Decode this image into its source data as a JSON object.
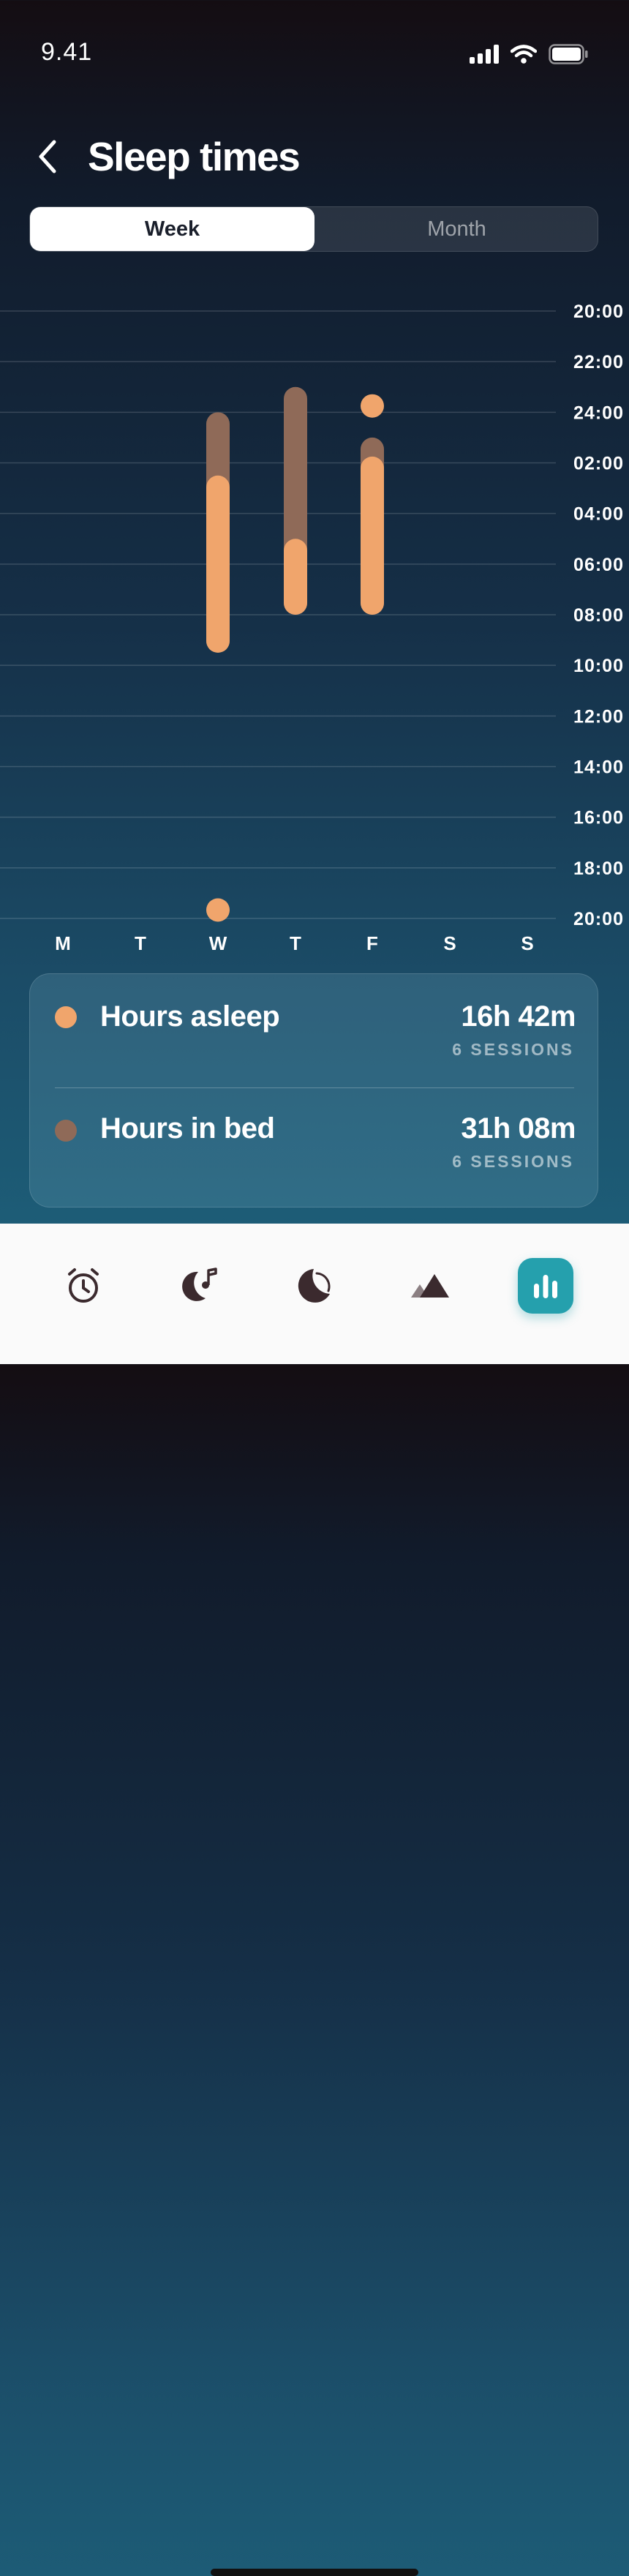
{
  "status_bar": {
    "time": "9.41",
    "icons": [
      "signal-icon",
      "wifi-icon",
      "battery-icon"
    ]
  },
  "header": {
    "back_icon": "chevron-left-icon",
    "title": "Sleep times"
  },
  "segmented": {
    "options": [
      "Week",
      "Month"
    ],
    "selected": "Week"
  },
  "chart_data": {
    "type": "range-bar",
    "days": [
      "M",
      "T",
      "W",
      "T",
      "F",
      "S",
      "S"
    ],
    "y_ticks": [
      "20:00",
      "22:00",
      "24:00",
      "02:00",
      "04:00",
      "06:00",
      "08:00",
      "10:00",
      "12:00",
      "14:00",
      "16:00",
      "18:00",
      "20:00"
    ],
    "y_range_hours_from_20": [
      0,
      24
    ],
    "colors": {
      "asleep": "#f0a56c",
      "in_bed": "#8f6a58"
    },
    "series": [
      {
        "name": "Hours in bed",
        "ranges": [
          {
            "day": "W",
            "start": "24:00",
            "end": "09:30"
          },
          {
            "day": "T",
            "start": "23:00",
            "end": "08:00"
          },
          {
            "day": "F",
            "start": "01:00",
            "end": "08:00"
          }
        ],
        "points": []
      },
      {
        "name": "Hours asleep",
        "ranges": [
          {
            "day": "W",
            "start": "02:30",
            "end": "09:30"
          },
          {
            "day": "T",
            "start": "05:00",
            "end": "08:00"
          },
          {
            "day": "F",
            "start": "01:45",
            "end": "08:00"
          }
        ],
        "points": [
          {
            "day": "F",
            "time": "23:45"
          },
          {
            "day": "W",
            "time": "19:40"
          }
        ]
      }
    ]
  },
  "summary": {
    "rows": [
      {
        "label": "Hours asleep",
        "value": "16h 42m",
        "sub": "6 SESSIONS",
        "color": "#f0a56c"
      },
      {
        "label": "Hours in bed",
        "value": "31h 08m",
        "sub": "6 SESSIONS",
        "color": "#8f6a58"
      }
    ]
  },
  "tab_bar": {
    "tabs": [
      "alarm-clock-icon",
      "sleep-sounds-icon",
      "moon-icon",
      "mountains-icon",
      "statistics-icon"
    ],
    "active": "statistics-icon"
  }
}
